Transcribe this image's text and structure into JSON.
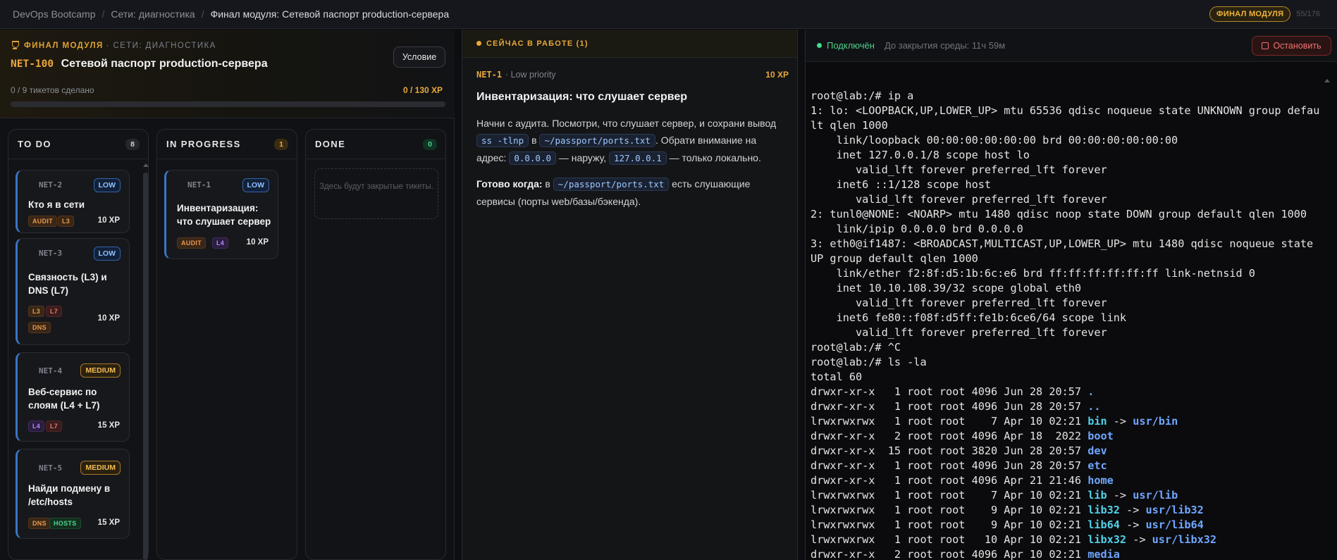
{
  "breadcrumb": {
    "items": [
      "DevOps Bootcamp",
      "Сети: диагностика"
    ],
    "current": "Финал модуля: Сетевой паспорт production-сервера",
    "badge": "ФИНАЛ МОДУЛЯ",
    "progress": "55/176"
  },
  "module": {
    "kicker": "ФИНАЛ МОДУЛЯ",
    "kicker_sub": "· СЕТИ: ДИАГНОСТИКА",
    "code": "NET-100",
    "title": "Сетевой паспорт production-сервера",
    "condition_button": "Условие",
    "tickets_done": "0 / 9 тикетов сделано",
    "xp": "0 / 130 XP",
    "progress_fraction": 0
  },
  "board": {
    "todo": {
      "title": "TO DO",
      "count": "8",
      "cards": [
        {
          "id": "NET-2",
          "priority": "LOW",
          "title": "Кто я в сети",
          "tags": [
            "AUDIT",
            "L3"
          ],
          "xp": "10 XP"
        },
        {
          "id": "NET-3",
          "priority": "LOW",
          "title": "Связность (L3) и DNS (L7)",
          "tags": [
            "L3",
            "L7",
            "DNS"
          ],
          "xp": "10 XP"
        },
        {
          "id": "NET-4",
          "priority": "MEDIUM",
          "title": "Веб-сервис по слоям (L4 + L7)",
          "tags": [
            "L4",
            "L7"
          ],
          "xp": "15 XP"
        },
        {
          "id": "NET-5",
          "priority": "MEDIUM",
          "title": "Найди подмену в /etc/hosts",
          "tags": [
            "DNS",
            "HOSTS"
          ],
          "xp": "15 XP"
        }
      ]
    },
    "in_progress": {
      "title": "IN PROGRESS",
      "count": "1",
      "cards": [
        {
          "id": "NET-1",
          "priority": "LOW",
          "title": "Инвентаризация: что слушает сервер",
          "tags": [
            "AUDIT",
            "L4"
          ],
          "xp": "10 XP"
        }
      ]
    },
    "done": {
      "title": "DONE",
      "count": "0",
      "empty": "Здесь будут закрытые тикеты."
    }
  },
  "current": {
    "header": "СЕЙЧАС В РАБОТЕ (1)",
    "id": "NET-1",
    "priority": "· Low priority",
    "xp": "10 XP",
    "title": "Инвентаризация: что слушает сервер",
    "p1_a": "Начни с аудита. Посмотри, что слушает сервер, и сохрани вывод ",
    "p1_code1": "ss -tlnp",
    "p1_b": " в ",
    "p1_code2": "~/passport/ports.txt",
    "p1_c": ". Обрати внимание на адрес: ",
    "p1_code3": "0.0.0.0",
    "p1_d": " — наружу, ",
    "p1_code4": "127.0.0.1",
    "p1_e": " — только локально.",
    "p2_strong": "Готово когда:",
    "p2_a": " в ",
    "p2_code": "~/passport/ports.txt",
    "p2_b": " есть слушающие сервисы (порты web/базы/бэкенда)."
  },
  "terminal": {
    "status": "Подключён",
    "env_close": "До закрытия среды: 11ч 59м",
    "stop_button": "Остановить",
    "lines": [
      "root@lab:/# ip a",
      "1: lo: <LOOPBACK,UP,LOWER_UP> mtu 65536 qdisc noqueue state UNKNOWN group defau",
      "lt qlen 1000",
      "    link/loopback 00:00:00:00:00:00 brd 00:00:00:00:00:00",
      "    inet 127.0.0.1/8 scope host lo",
      "       valid_lft forever preferred_lft forever",
      "    inet6 ::1/128 scope host",
      "       valid_lft forever preferred_lft forever",
      "2: tunl0@NONE: <NOARP> mtu 1480 qdisc noop state DOWN group default qlen 1000",
      "    link/ipip 0.0.0.0 brd 0.0.0.0",
      "3: eth0@if1487: <BROADCAST,MULTICAST,UP,LOWER_UP> mtu 1480 qdisc noqueue state",
      "UP group default qlen 1000",
      "    link/ether f2:8f:d5:1b:6c:e6 brd ff:ff:ff:ff:ff:ff link-netnsid 0",
      "    inet 10.10.108.39/32 scope global eth0",
      "       valid_lft forever preferred_lft forever",
      "    inet6 fe80::f08f:d5ff:fe1b:6ce6/64 scope link",
      "       valid_lft forever preferred_lft forever",
      "root@lab:/# ^C",
      "root@lab:/# ls -la",
      "total 60"
    ],
    "listing": [
      {
        "perm": "drwxr-xr-x   1 root root 4096 Jun 28 20:57 ",
        "name": ".",
        "kind": "dir",
        "target": ""
      },
      {
        "perm": "drwxr-xr-x   1 root root 4096 Jun 28 20:57 ",
        "name": "..",
        "kind": "dir",
        "target": ""
      },
      {
        "perm": "lrwxrwxrwx   1 root root    7 Apr 10 02:21 ",
        "name": "bin",
        "kind": "link",
        "target": "usr/bin"
      },
      {
        "perm": "drwxr-xr-x   2 root root 4096 Apr 18  2022 ",
        "name": "boot",
        "kind": "dir",
        "target": ""
      },
      {
        "perm": "drwxr-xr-x  15 root root 3820 Jun 28 20:57 ",
        "name": "dev",
        "kind": "dir",
        "target": ""
      },
      {
        "perm": "drwxr-xr-x   1 root root 4096 Jun 28 20:57 ",
        "name": "etc",
        "kind": "dir",
        "target": ""
      },
      {
        "perm": "drwxr-xr-x   1 root root 4096 Apr 21 21:46 ",
        "name": "home",
        "kind": "dir",
        "target": ""
      },
      {
        "perm": "lrwxrwxrwx   1 root root    7 Apr 10 02:21 ",
        "name": "lib",
        "kind": "link",
        "target": "usr/lib"
      },
      {
        "perm": "lrwxrwxrwx   1 root root    9 Apr 10 02:21 ",
        "name": "lib32",
        "kind": "link",
        "target": "usr/lib32"
      },
      {
        "perm": "lrwxrwxrwx   1 root root    9 Apr 10 02:21 ",
        "name": "lib64",
        "kind": "link",
        "target": "usr/lib64"
      },
      {
        "perm": "lrwxrwxrwx   1 root root   10 Apr 10 02:21 ",
        "name": "libx32",
        "kind": "link",
        "target": "usr/libx32"
      },
      {
        "perm": "drwxr-xr-x   2 root root 4096 Apr 10 02:21 ",
        "name": "media",
        "kind": "dir",
        "target": ""
      }
    ],
    "arrow": " -> "
  },
  "colors": {
    "accent": "#e8a93a",
    "low": "#8ec0ff",
    "medium": "#f2bd55",
    "connected": "#4ed28a",
    "stop": "#f27272"
  }
}
